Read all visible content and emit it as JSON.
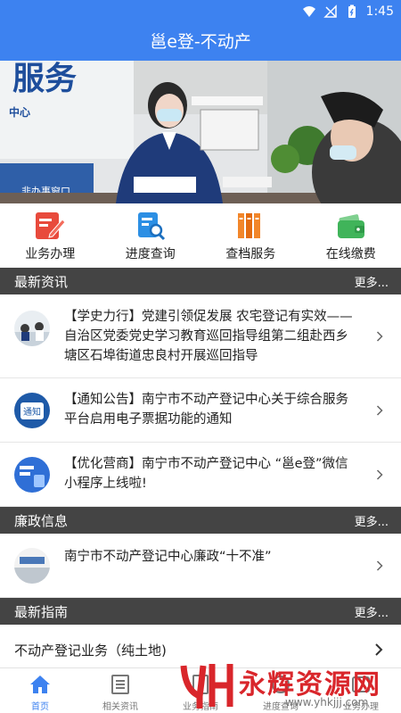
{
  "status_bar": {
    "time": "1:45"
  },
  "app": {
    "title": "邕e登-不动产"
  },
  "banner": {
    "sign_big": "服务",
    "sign_sub": "中心",
    "window_sign": "非办事窗口"
  },
  "quick_menu": [
    {
      "label": "业务办理",
      "icon": "edit-doc-icon",
      "color": "#e84a3c"
    },
    {
      "label": "进度查询",
      "icon": "search-doc-icon",
      "color": "#2c8fe4"
    },
    {
      "label": "查档服务",
      "icon": "archive-icon",
      "color": "#f2862a"
    },
    {
      "label": "在线缴费",
      "icon": "wallet-icon",
      "color": "#40b45a"
    }
  ],
  "news": {
    "title": "最新资讯",
    "more": "更多...",
    "items": [
      {
        "text": "【学史力行】党建引领促发展 农宅登记有实效——自治区党委党史学习教育巡回指导组第二组赴西乡塘区石埠街道忠良村开展巡回指导"
      },
      {
        "text": "【通知公告】南宁市不动产登记中心关于综合服务平台启用电子票据功能的通知",
        "thumb_text": "通知"
      },
      {
        "text": "【优化营商】南宁市不动产登记中心 “邕e登”微信小程序上线啦!"
      }
    ]
  },
  "integrity": {
    "title": "廉政信息",
    "more": "更多...",
    "items": [
      {
        "text": "南宁市不动产登记中心廉政“十不准”"
      }
    ]
  },
  "guide": {
    "title": "最新指南",
    "more": "更多...",
    "items": [
      {
        "text": "不动产登记业务（纯土地)"
      }
    ]
  },
  "bottom_nav": [
    {
      "label": "首页",
      "icon": "home-icon",
      "active": true
    },
    {
      "label": "相关资讯",
      "icon": "news-icon",
      "active": false
    },
    {
      "label": "业务指南",
      "icon": "guide-icon",
      "active": false
    },
    {
      "label": "进度查询",
      "icon": "progress-icon",
      "active": false
    },
    {
      "label": "业务办理",
      "icon": "business-icon",
      "active": false
    }
  ],
  "watermark": {
    "brand": "永辉资源网",
    "url": "www.yhkjjj.com",
    "logo_letters": "YH"
  },
  "colors": {
    "primary": "#3d82f0",
    "section_bg": "#444444",
    "watermark_red": "#d9262b"
  }
}
